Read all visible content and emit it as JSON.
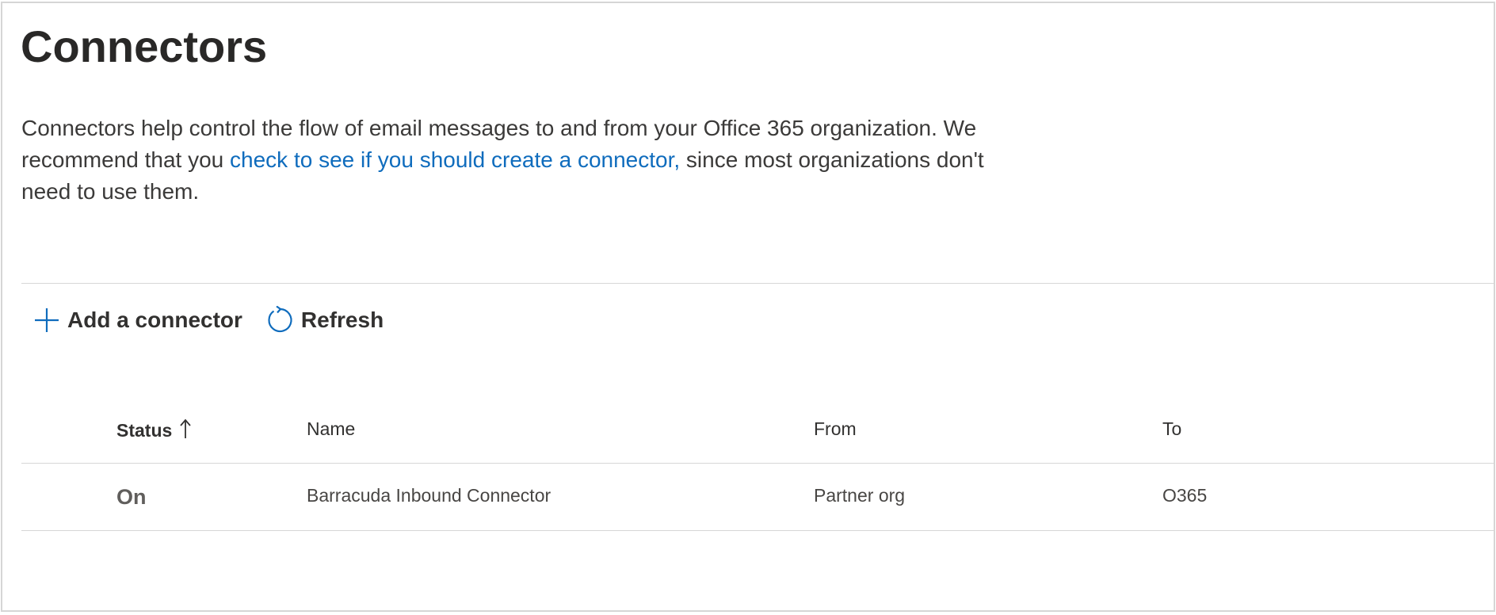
{
  "page": {
    "title": "Connectors",
    "description": {
      "before_link": "Connectors help control the flow of email messages to and from your Office 365 organization. We recommend that you ",
      "link_text": "check to see if you should create a connector,",
      "after_link": " since most organizations don't need to use them."
    },
    "link_color": "#0f6cbd"
  },
  "toolbar": {
    "add_label": "Add a connector",
    "add_icon": "plus-icon",
    "refresh_label": "Refresh",
    "refresh_icon": "refresh-icon"
  },
  "table": {
    "columns": {
      "status": "Status",
      "name": "Name",
      "from": "From",
      "to": "To"
    },
    "sort": {
      "column": "status",
      "direction": "ascending",
      "icon": "arrow-up-icon"
    },
    "rows": [
      {
        "status": "On",
        "name": "Barracuda Inbound Connector",
        "from": "Partner org",
        "to": "O365"
      }
    ]
  }
}
